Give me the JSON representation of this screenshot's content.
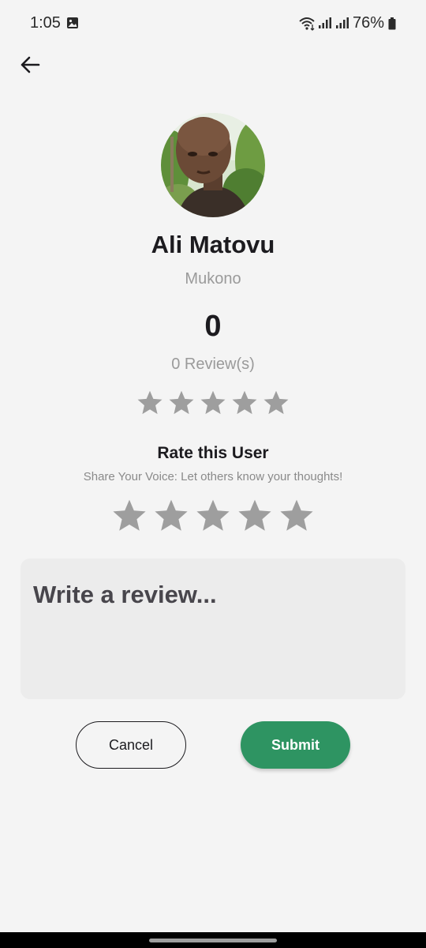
{
  "status_bar": {
    "time": "1:05",
    "battery": "76%",
    "icons": [
      "gallery-icon",
      "wifi-icon",
      "signal-icon",
      "signal-icon",
      "battery-icon"
    ]
  },
  "header": {
    "back_icon": "arrow-left-icon"
  },
  "profile": {
    "name": "Ali Matovu",
    "location": "Mukono",
    "rating": "0",
    "reviews": "0 Review(s)",
    "stars_filled": 0,
    "stars_total": 5
  },
  "rate_section": {
    "title": "Rate this User",
    "subtitle": "Share Your Voice: Let others know your thoughts!",
    "selected_stars": 0,
    "stars_total": 5
  },
  "review_input": {
    "placeholder": "Write a review..."
  },
  "actions": {
    "cancel_label": "Cancel",
    "submit_label": "Submit"
  },
  "colors": {
    "accent": "#2e9462",
    "background": "#f4f4f4",
    "star_empty": "#9e9e9e",
    "text_primary": "#1c1b1f",
    "text_secondary": "#9a9a9a",
    "input_background": "#ececec"
  }
}
